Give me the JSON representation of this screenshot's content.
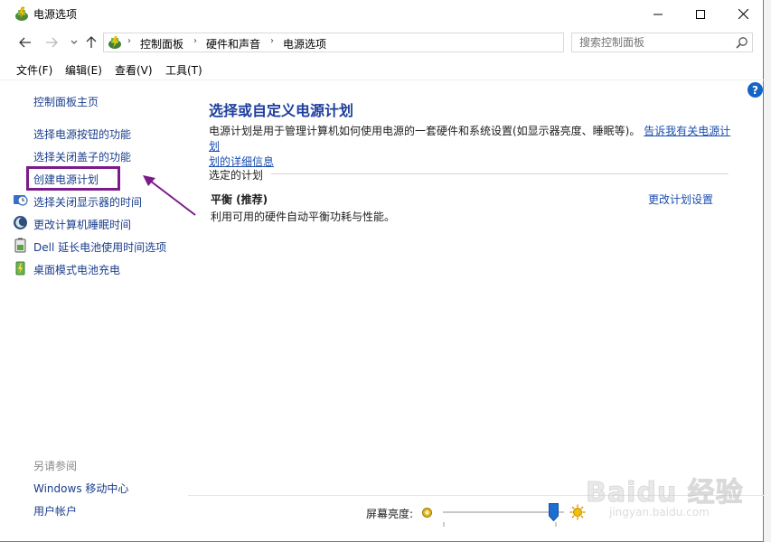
{
  "window": {
    "title": "电源选项",
    "controls": {
      "minimize": "minimize",
      "maximize": "maximize",
      "close": "close"
    }
  },
  "address": {
    "breadcrumbs": [
      "控制面板",
      "硬件和声音",
      "电源选项"
    ],
    "search_placeholder": "搜索控制面板"
  },
  "menu": {
    "items": [
      "文件(F)",
      "编辑(E)",
      "查看(V)",
      "工具(T)"
    ]
  },
  "sidebar": {
    "home": "控制面板主页",
    "links": [
      "选择电源按钮的功能",
      "选择关闭盖子的功能",
      "创建电源计划",
      "选择关闭显示器的时间",
      "更改计算机睡眠时间",
      "Dell 延长电池使用时间选项",
      "桌面模式电池充电"
    ],
    "see_also_title": "另请参阅",
    "see_also_links": [
      "Windows 移动中心",
      "用户帐户"
    ]
  },
  "main": {
    "title": "选择或自定义电源计划",
    "desc_text": "电源计划是用于管理计算机如何使用电源的一套硬件和系统设置(如显示器亮度、睡眠等)。",
    "desc_link_1": "告诉我有关电源计划",
    "desc_link_2": "划的详细信息",
    "section_title": "选定的计划",
    "plan": {
      "name": "平衡 (推荐)",
      "description": "利用可用的硬件自动平衡功耗与性能。",
      "change_label": "更改计划设置"
    }
  },
  "brightness": {
    "label": "屏幕亮度:",
    "level": 0.95
  },
  "watermark": {
    "main": "Baidu 经验",
    "sub": "jingyan.baidu.com"
  },
  "colors": {
    "link": "#1a3e8c",
    "title_blue": "#1e3f9e",
    "highlight_box": "#7b1b8a",
    "annotation_arrow": "#7b1b8a"
  }
}
